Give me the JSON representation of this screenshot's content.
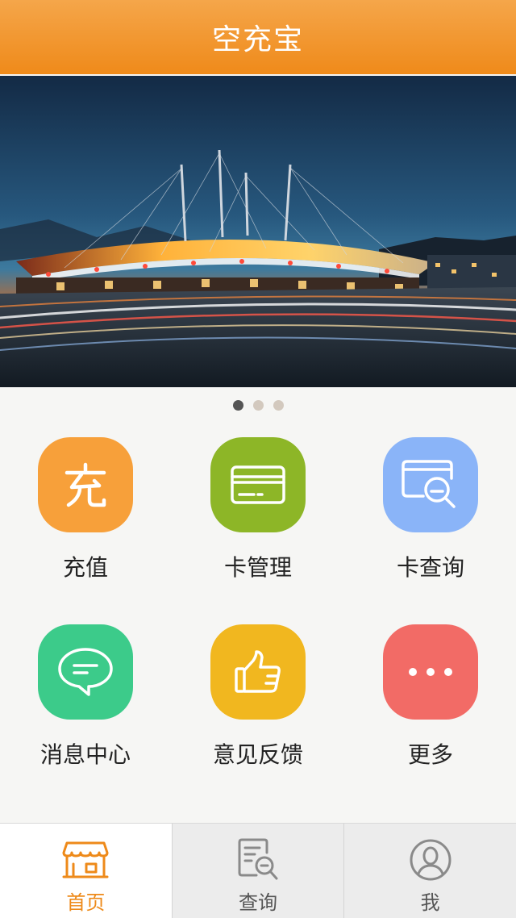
{
  "header": {
    "title": "空充宝"
  },
  "banner": {
    "slide_count": 3,
    "active_slide": 1
  },
  "menu": {
    "items": [
      {
        "label": "充值",
        "icon": "recharge-icon",
        "glyph": "充",
        "color": "#f7a03a"
      },
      {
        "label": "卡管理",
        "icon": "card-icon",
        "color": "#8db627"
      },
      {
        "label": "卡查询",
        "icon": "card-search-icon",
        "color": "#8ab4f8"
      },
      {
        "label": "消息中心",
        "icon": "message-icon",
        "color": "#3ccb8a"
      },
      {
        "label": "意见反馈",
        "icon": "thumbs-up-icon",
        "color": "#f1b71f"
      },
      {
        "label": "更多",
        "icon": "more-icon",
        "color": "#f26b66"
      }
    ]
  },
  "tabbar": {
    "tabs": [
      {
        "label": "首页",
        "icon": "home-store-icon",
        "active": true
      },
      {
        "label": "查询",
        "icon": "query-icon",
        "active": false
      },
      {
        "label": "我",
        "icon": "profile-icon",
        "active": false
      }
    ]
  },
  "colors": {
    "accent": "#ef8a1a",
    "background": "#f6f6f4"
  }
}
